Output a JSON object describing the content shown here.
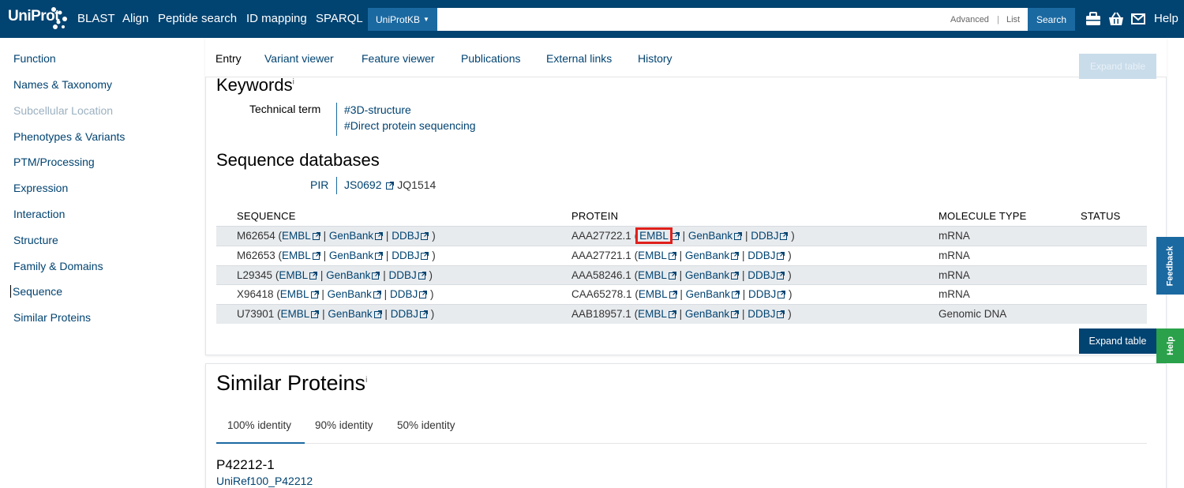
{
  "header": {
    "logo": "UniProt",
    "nav": [
      "BLAST",
      "Align",
      "Peptide search",
      "ID mapping",
      "SPARQL"
    ],
    "db_select": "UniProtKB",
    "search_placeholder": "",
    "advanced": "Advanced",
    "list": "List",
    "search_button": "Search",
    "help": "Help",
    "icons": [
      "toolbox-icon",
      "basket-icon",
      "envelope-icon"
    ]
  },
  "sidebar": {
    "items": [
      {
        "label": "Function"
      },
      {
        "label": "Names & Taxonomy"
      },
      {
        "label": "Subcellular Location"
      },
      {
        "label": "Phenotypes & Variants"
      },
      {
        "label": "PTM/Processing"
      },
      {
        "label": "Expression"
      },
      {
        "label": "Interaction"
      },
      {
        "label": "Structure"
      },
      {
        "label": "Family & Domains"
      },
      {
        "label": "Sequence"
      },
      {
        "label": "Similar Proteins"
      }
    ]
  },
  "tabs": [
    "Entry",
    "Variant viewer",
    "Feature viewer",
    "Publications",
    "External links",
    "History"
  ],
  "expand_table_faded": "Expand table",
  "keywords": {
    "title": "Keywords",
    "sup": "i",
    "label": "Technical term",
    "values": [
      "#3D-structure",
      "#Direct protein sequencing"
    ]
  },
  "sequence_databases": {
    "title": "Sequence databases",
    "pir_label": "PIR",
    "pir_link": "JS0692",
    "pir_extra": "JQ1514"
  },
  "table": {
    "headers": [
      "SEQUENCE",
      "PROTEIN",
      "MOLECULE TYPE",
      "STATUS"
    ],
    "rows": [
      {
        "seq": "M62654",
        "protein": "AAA27722.1",
        "type": "mRNA"
      },
      {
        "seq": "M62653",
        "protein": "AAA27721.1",
        "type": "mRNA"
      },
      {
        "seq": "L29345",
        "protein": "AAA58246.1",
        "type": "mRNA"
      },
      {
        "seq": "X96418",
        "protein": "CAA65278.1",
        "type": "mRNA"
      },
      {
        "seq": "U73901",
        "protein": "AAB18957.1",
        "type": "Genomic DNA"
      }
    ],
    "link_labels": [
      "EMBL",
      "GenBank",
      "DDBJ"
    ]
  },
  "expand_table": "Expand table",
  "side_tabs": {
    "feedback": "Feedback",
    "help": "Help"
  },
  "similar_proteins": {
    "title": "Similar Proteins",
    "sup": "i",
    "tabs": [
      "100% identity",
      "90% identity",
      "50% identity"
    ],
    "entry_id": "P42212-1",
    "cluster_link": "UniRef100_P42212"
  },
  "colors": {
    "header_bg": "#014371",
    "link": "#014371",
    "button": "#014371",
    "feedback_tab": "#1b69a1",
    "help_tab": "#2aa14a",
    "highlight": "#e0201b"
  }
}
